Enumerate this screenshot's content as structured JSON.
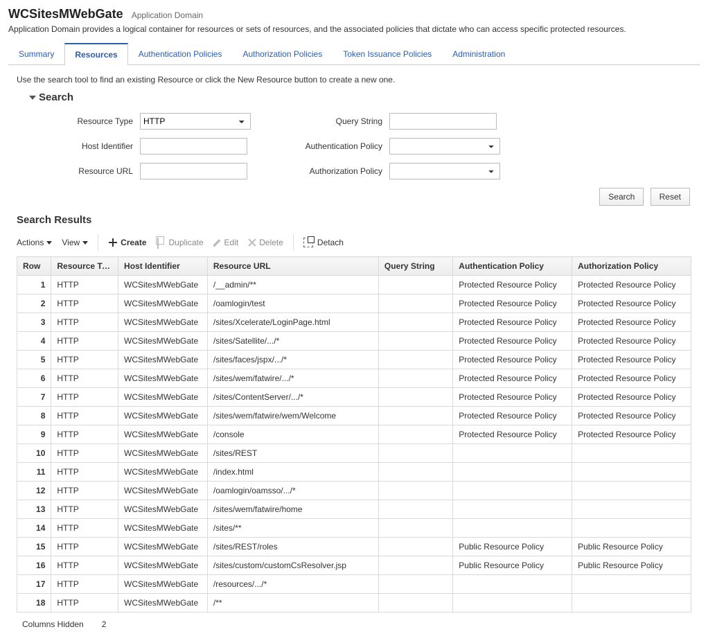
{
  "header": {
    "title": "WCSitesMWebGate",
    "subtitle": "Application Domain",
    "description": "Application Domain provides a logical container for resources or sets of resources, and the associated policies that dictate who can access specific protected resources."
  },
  "tabs": [
    {
      "label": "Summary",
      "active": false
    },
    {
      "label": "Resources",
      "active": true
    },
    {
      "label": "Authentication Policies",
      "active": false
    },
    {
      "label": "Authorization Policies",
      "active": false
    },
    {
      "label": "Token Issuance Policies",
      "active": false
    },
    {
      "label": "Administration",
      "active": false
    }
  ],
  "help_text": "Use the search tool to find an existing Resource or click the New Resource button to create a new one.",
  "search": {
    "title": "Search",
    "fields": {
      "resource_type": {
        "label": "Resource Type",
        "value": "HTTP"
      },
      "host_identifier": {
        "label": "Host Identifier",
        "value": ""
      },
      "resource_url": {
        "label": "Resource URL",
        "value": ""
      },
      "query_string": {
        "label": "Query String",
        "value": ""
      },
      "authn_policy": {
        "label": "Authentication Policy",
        "value": ""
      },
      "authz_policy": {
        "label": "Authorization Policy",
        "value": ""
      }
    },
    "buttons": {
      "search": "Search",
      "reset": "Reset"
    }
  },
  "results": {
    "title": "Search Results",
    "toolbar": {
      "actions": "Actions",
      "view": "View",
      "create": "Create",
      "duplicate": "Duplicate",
      "edit": "Edit",
      "delete": "Delete",
      "detach": "Detach"
    },
    "columns": [
      "Row",
      "Resource Type",
      "Host Identifier",
      "Resource URL",
      "Query String",
      "Authentication Policy",
      "Authorization Policy"
    ],
    "rows": [
      {
        "n": "1",
        "type": "HTTP",
        "host": "WCSitesMWebGate",
        "url": "/__admin/**",
        "qs": "",
        "authn": "Protected Resource Policy",
        "authz": "Protected Resource Policy"
      },
      {
        "n": "2",
        "type": "HTTP",
        "host": "WCSitesMWebGate",
        "url": "/oamlogin/test",
        "qs": "",
        "authn": "Protected Resource Policy",
        "authz": "Protected Resource Policy"
      },
      {
        "n": "3",
        "type": "HTTP",
        "host": "WCSitesMWebGate",
        "url": "/sites/Xcelerate/LoginPage.html",
        "qs": "",
        "authn": "Protected Resource Policy",
        "authz": "Protected Resource Policy"
      },
      {
        "n": "4",
        "type": "HTTP",
        "host": "WCSitesMWebGate",
        "url": "/sites/Satellite/.../*",
        "qs": "",
        "authn": "Protected Resource Policy",
        "authz": "Protected Resource Policy"
      },
      {
        "n": "5",
        "type": "HTTP",
        "host": "WCSitesMWebGate",
        "url": "/sites/faces/jspx/.../*",
        "qs": "",
        "authn": "Protected Resource Policy",
        "authz": "Protected Resource Policy"
      },
      {
        "n": "6",
        "type": "HTTP",
        "host": "WCSitesMWebGate",
        "url": "/sites/wem/fatwire/.../*",
        "qs": "",
        "authn": "Protected Resource Policy",
        "authz": "Protected Resource Policy"
      },
      {
        "n": "7",
        "type": "HTTP",
        "host": "WCSitesMWebGate",
        "url": "/sites/ContentServer/.../*",
        "qs": "",
        "authn": "Protected Resource Policy",
        "authz": "Protected Resource Policy"
      },
      {
        "n": "8",
        "type": "HTTP",
        "host": "WCSitesMWebGate",
        "url": "/sites/wem/fatwire/wem/Welcome",
        "qs": "",
        "authn": "Protected Resource Policy",
        "authz": "Protected Resource Policy"
      },
      {
        "n": "9",
        "type": "HTTP",
        "host": "WCSitesMWebGate",
        "url": "/console",
        "qs": "",
        "authn": "Protected Resource Policy",
        "authz": "Protected Resource Policy"
      },
      {
        "n": "10",
        "type": "HTTP",
        "host": "WCSitesMWebGate",
        "url": "/sites/REST",
        "qs": "",
        "authn": "",
        "authz": ""
      },
      {
        "n": "11",
        "type": "HTTP",
        "host": "WCSitesMWebGate",
        "url": "/index.html",
        "qs": "",
        "authn": "",
        "authz": ""
      },
      {
        "n": "12",
        "type": "HTTP",
        "host": "WCSitesMWebGate",
        "url": "/oamlogin/oamsso/.../*",
        "qs": "",
        "authn": "",
        "authz": ""
      },
      {
        "n": "13",
        "type": "HTTP",
        "host": "WCSitesMWebGate",
        "url": "/sites/wem/fatwire/home",
        "qs": "",
        "authn": "",
        "authz": ""
      },
      {
        "n": "14",
        "type": "HTTP",
        "host": "WCSitesMWebGate",
        "url": "/sites/**",
        "qs": "",
        "authn": "",
        "authz": ""
      },
      {
        "n": "15",
        "type": "HTTP",
        "host": "WCSitesMWebGate",
        "url": "/sites/REST/roles",
        "qs": "",
        "authn": "Public Resource Policy",
        "authz": "Public Resource Policy"
      },
      {
        "n": "16",
        "type": "HTTP",
        "host": "WCSitesMWebGate",
        "url": "/sites/custom/customCsResolver.jsp",
        "qs": "",
        "authn": "Public Resource Policy",
        "authz": "Public Resource Policy"
      },
      {
        "n": "17",
        "type": "HTTP",
        "host": "WCSitesMWebGate",
        "url": "/resources/.../*",
        "qs": "",
        "authn": "",
        "authz": ""
      },
      {
        "n": "18",
        "type": "HTTP",
        "host": "WCSitesMWebGate",
        "url": "/**",
        "qs": "",
        "authn": "",
        "authz": ""
      }
    ],
    "columns_hidden_label": "Columns Hidden",
    "columns_hidden_count": "2"
  }
}
